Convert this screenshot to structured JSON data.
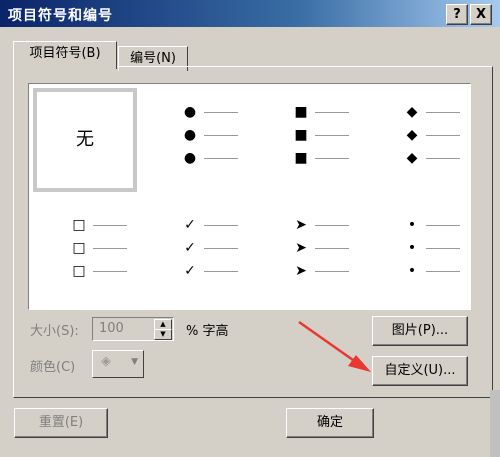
{
  "window": {
    "title": "项目符号和编号",
    "help": "?",
    "close": "X"
  },
  "tabs": [
    {
      "label": "项目符号(B)"
    },
    {
      "label": "编号(N)"
    }
  ],
  "gallery": {
    "none_label": "无",
    "styles": [
      "none-icon",
      "filled-circle-icon",
      "filled-square-icon",
      "filled-diamond-icon",
      "hollow-square-icon",
      "checkmark-icon",
      "arrowhead-icon",
      "small-dot-icon"
    ],
    "glyphs": {
      "filled-circle-icon": "●",
      "filled-square-icon": "■",
      "filled-diamond-icon": "◆",
      "hollow-square-icon": "□",
      "checkmark-icon": "✓",
      "arrowhead-icon": "➤",
      "small-dot-icon": "•"
    },
    "selected": "none-icon"
  },
  "size": {
    "label": "大小(S):",
    "value": "100",
    "unit": "% 字高"
  },
  "color": {
    "label": "颜色(C)"
  },
  "buttons": {
    "picture": "图片(P)...",
    "customize": "自定义(U)...",
    "reset": "重置(E)",
    "ok": "确定"
  },
  "colors": {
    "accent": "#e8382f",
    "titlebar": "#0a246a"
  }
}
